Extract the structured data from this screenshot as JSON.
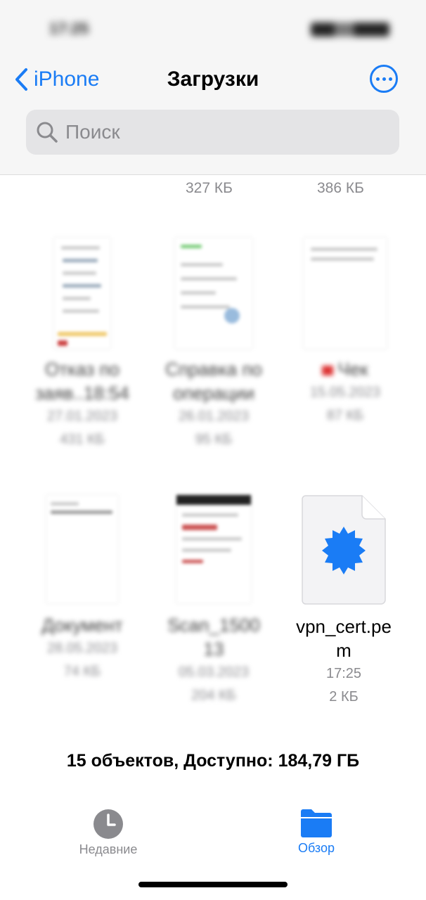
{
  "status": {
    "time": "17:25"
  },
  "nav": {
    "back_label": "iPhone",
    "title": "Загрузки"
  },
  "search": {
    "placeholder": "Поиск"
  },
  "top_sizes": [
    "327 КБ",
    "386 КБ"
  ],
  "files": [
    {
      "name_line1": "Отказ по",
      "name_line2": "заяв..18:54",
      "date": "27.01.2023",
      "size": "431 КБ"
    },
    {
      "name_line1": "Справка по",
      "name_line2": "операции",
      "date": "26.01.2023",
      "size": "95 КБ"
    },
    {
      "name_line1": "Чек",
      "name_line2": "",
      "date": "15.05.2023",
      "size": "87 КБ"
    },
    {
      "name_line1": "Документ",
      "name_line2": "",
      "date": "28.05.2023",
      "size": "74 КБ"
    },
    {
      "name_line1": "Scan_1500",
      "name_line2": "13",
      "date": "05.03.2023",
      "size": "204 КБ"
    },
    {
      "name_line1": "vpn_cert.pe",
      "name_line2": "m",
      "date": "17:25",
      "size": "2 КБ"
    }
  ],
  "footer": {
    "count_text": "15 объектов, Доступно: 184,79 ГБ"
  },
  "tabs": {
    "recent": "Недавние",
    "browse": "Обзор"
  },
  "colors": {
    "accent": "#1a7cf5",
    "inactive": "#8a8a8e"
  }
}
